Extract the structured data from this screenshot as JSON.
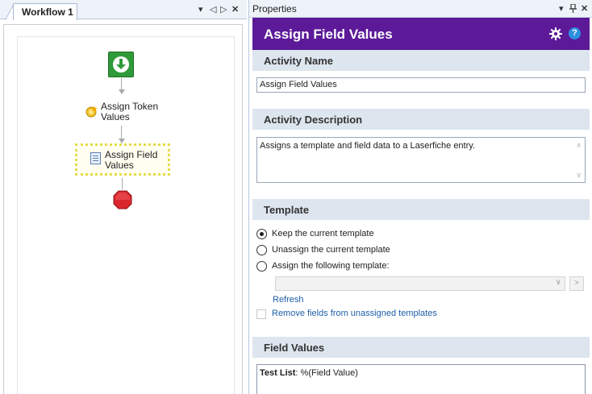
{
  "workflow_tab": {
    "title": "Workflow 1",
    "controls": {
      "dropdown": "▾",
      "prev": "◁",
      "next": "▷",
      "close": "✕"
    }
  },
  "designer": {
    "nodes": [
      {
        "kind": "start"
      },
      {
        "kind": "activity",
        "label_line1": "Assign Token",
        "label_line2": "Values"
      },
      {
        "kind": "activity",
        "label_line1": "Assign Field",
        "label_line2": "Values",
        "selected": true
      },
      {
        "kind": "end"
      }
    ]
  },
  "properties": {
    "pane_title": "Properties",
    "controls": {
      "dropdown": "▾",
      "pin": "ꟸ",
      "close": "✕"
    },
    "activity_title": "Assign Field Values",
    "header_color": "#5c1a99",
    "icons": [
      "gear-icon",
      "help-icon"
    ],
    "help_glyph": "?",
    "activity_name": {
      "heading": "Activity Name",
      "value": "Assign Field Values"
    },
    "activity_description": {
      "heading": "Activity Description",
      "value": "Assigns a template and field data to a Laserfiche entry."
    },
    "template": {
      "heading": "Template",
      "options": [
        {
          "label": "Keep the current template",
          "checked": true
        },
        {
          "label": "Unassign the current template",
          "checked": false
        },
        {
          "label": "Assign the following template:",
          "checked": false
        }
      ],
      "selected_template": "",
      "go_glyph": ">",
      "refresh_label": "Refresh",
      "remove_fields_label": "Remove fields from unassigned templates",
      "remove_fields_checked": false
    },
    "field_values": {
      "heading": "Field Values",
      "rows": [
        {
          "name": "Test List",
          "separator": ":",
          "value": "%(Field Value)"
        }
      ]
    }
  }
}
